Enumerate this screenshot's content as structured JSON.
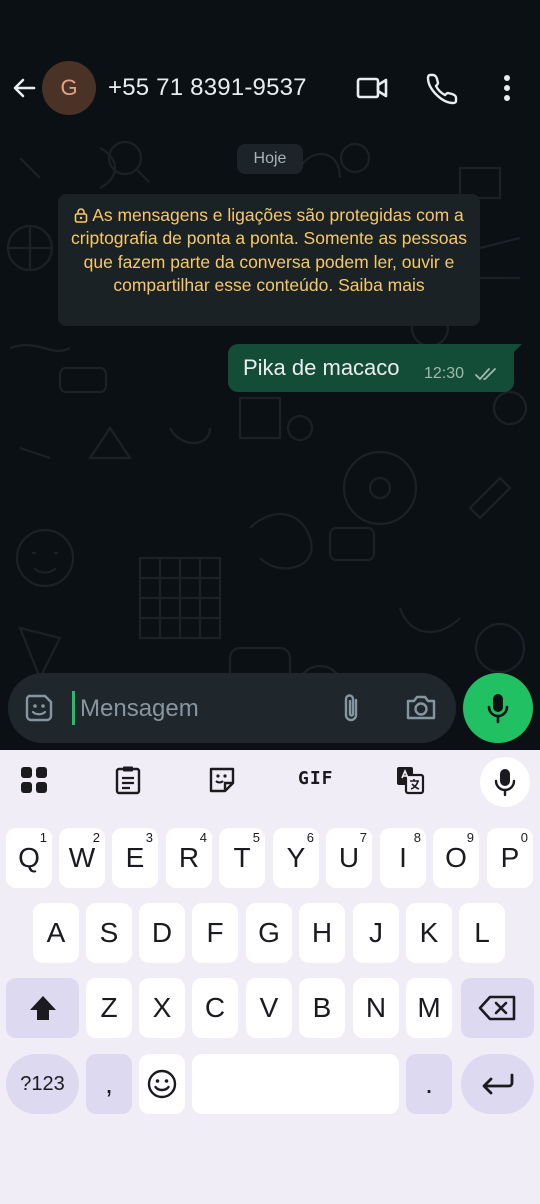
{
  "header": {
    "avatar_letter": "G",
    "contact_name": "+55 71 8391-9537"
  },
  "chat": {
    "date_chip": "Hoje",
    "encryption_notice": "As mensagens e ligações são protegidas com a criptografia de ponta a ponta. Somente as pessoas que fazem parte da conversa podem ler, ouvir e compartilhar esse conteúdo. Saiba mais",
    "messages": [
      {
        "text": "Pika de macaco",
        "time": "12:30",
        "status": "sent"
      }
    ]
  },
  "composer": {
    "placeholder": "Mensagem"
  },
  "keyboard": {
    "toolbar": [
      "apps-icon",
      "clipboard-icon",
      "sticker-icon",
      "gif-icon",
      "translate-icon",
      "mic-icon"
    ],
    "gif_label": "GIF",
    "row1": [
      {
        "k": "Q",
        "n": "1"
      },
      {
        "k": "W",
        "n": "2"
      },
      {
        "k": "E",
        "n": "3"
      },
      {
        "k": "R",
        "n": "4"
      },
      {
        "k": "T",
        "n": "5"
      },
      {
        "k": "Y",
        "n": "6"
      },
      {
        "k": "U",
        "n": "7"
      },
      {
        "k": "I",
        "n": "8"
      },
      {
        "k": "O",
        "n": "9"
      },
      {
        "k": "P",
        "n": "0"
      }
    ],
    "row2": [
      "A",
      "S",
      "D",
      "F",
      "G",
      "H",
      "J",
      "K",
      "L"
    ],
    "row3": [
      "Z",
      "X",
      "C",
      "V",
      "B",
      "N",
      "M"
    ],
    "symbols_label": "?123",
    "comma_label": ",",
    "period_label": "."
  },
  "colors": {
    "accent": "#21c063",
    "bubble_out": "#134d37",
    "notice_text": "#f7c86a"
  }
}
